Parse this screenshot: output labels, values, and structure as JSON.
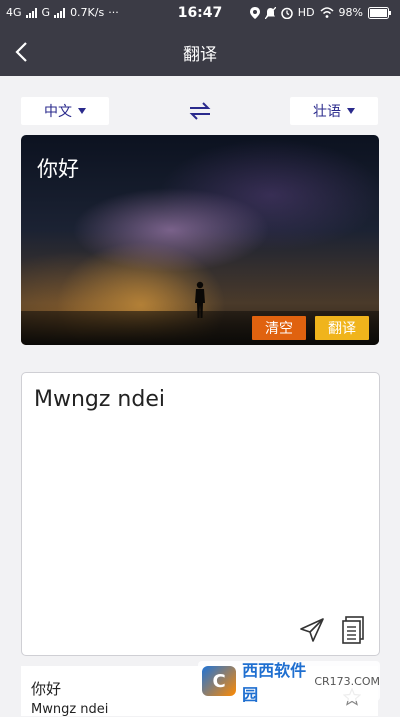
{
  "status": {
    "network1": "4G",
    "network2": "G",
    "speed": "0.7K/s",
    "dots": "···",
    "time": "16:47",
    "hd": "HD",
    "battery": "98%"
  },
  "appbar": {
    "title": "翻译"
  },
  "languages": {
    "source": "中文",
    "target": "壮语"
  },
  "input": {
    "text": "你好"
  },
  "actions": {
    "clear": "清空",
    "translate": "翻译"
  },
  "output": {
    "text": "Mwngz ndei"
  },
  "history": {
    "source": "你好",
    "target": "Mwngz ndei"
  },
  "watermark": {
    "logo": "C",
    "name": "西西软件园",
    "site": "CR173.COM"
  },
  "colors": {
    "bar": "#3b3b45",
    "accent": "#2a2a8c",
    "clear": "#e0620f",
    "translate": "#f0b41c"
  }
}
